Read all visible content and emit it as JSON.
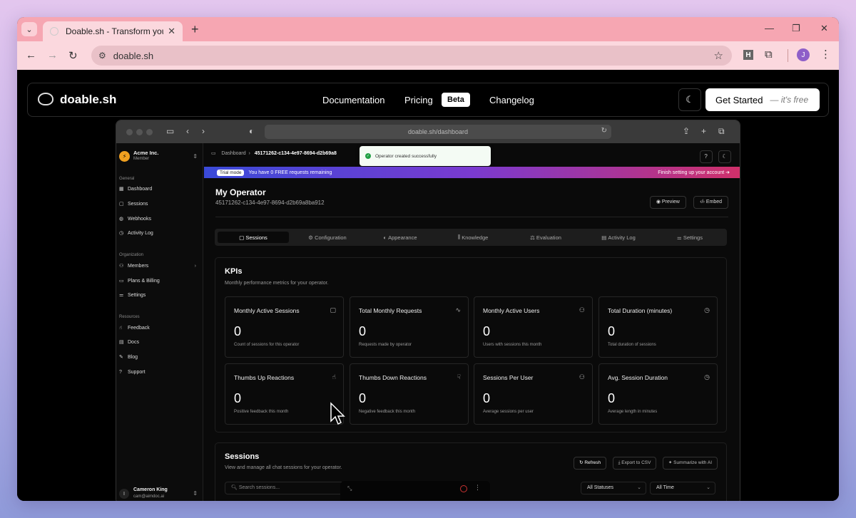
{
  "browser": {
    "tab_title": "Doable.sh - Transform your web",
    "url": "doable.sh",
    "profile_initial": "J",
    "extension_label": "H"
  },
  "site": {
    "logo": "doable.sh",
    "nav": [
      "Documentation",
      "Pricing",
      "Changelog"
    ],
    "beta_badge": "Beta",
    "cta_label": "Get Started",
    "cta_note": "— it's free"
  },
  "mock_browser": {
    "url": "doable.sh/dashboard"
  },
  "sidebar": {
    "org_name": "Acme Inc.",
    "org_role": "Member",
    "sections": [
      {
        "label": "General",
        "items": [
          "Dashboard",
          "Sessions",
          "Webhooks",
          "Activity Log"
        ]
      },
      {
        "label": "Organization",
        "items": [
          "Members",
          "Plans & Billing",
          "Settings"
        ]
      },
      {
        "label": "Resources",
        "items": [
          "Feedback",
          "Docs",
          "Blog",
          "Support"
        ]
      }
    ],
    "user_initial": "I",
    "user_name": "Cameron King",
    "user_email": "cam@aimdoc.ai"
  },
  "dashboard": {
    "breadcrumb_root": "Dashboard",
    "breadcrumb_current": "45171262-c134-4e97-8694-d2b69a8",
    "toast": "Operator created successfully",
    "trial_pill": "Trial mode",
    "trial_text": "You have 0 FREE requests remaining",
    "trial_action": "Finish setting up your account",
    "title": "My Operator",
    "operator_id": "45171262-c134-4e97-8694-d2b69a8ba912",
    "preview_label": "Preview",
    "embed_label": "Embed",
    "tabs": [
      "Sessions",
      "Configuration",
      "Appearance",
      "Knowledge",
      "Evaluation",
      "Activity Log",
      "Settings"
    ],
    "active_tab": "Sessions"
  },
  "kpis": {
    "title": "KPIs",
    "subtitle": "Monthly performance metrics for your operator.",
    "cards": [
      {
        "label": "Monthly Active Sessions",
        "value": "0",
        "desc": "Count of sessions for this operator",
        "icon": "chat-icon"
      },
      {
        "label": "Total Monthly Requests",
        "value": "0",
        "desc": "Requests made by operator",
        "icon": "activity-icon"
      },
      {
        "label": "Monthly Active Users",
        "value": "0",
        "desc": "Users with sessions this month",
        "icon": "users-icon"
      },
      {
        "label": "Total Duration (minutes)",
        "value": "0",
        "desc": "Total duration of sessions",
        "icon": "clock-icon"
      },
      {
        "label": "Thumbs Up Reactions",
        "value": "0",
        "desc": "Positive feedback this month",
        "icon": "thumbs-up-icon"
      },
      {
        "label": "Thumbs Down Reactions",
        "value": "0",
        "desc": "Negative feedback this month",
        "icon": "thumbs-down-icon"
      },
      {
        "label": "Sessions Per User",
        "value": "0",
        "desc": "Average sessions per user",
        "icon": "users-icon"
      },
      {
        "label": "Avg. Session Duration",
        "value": "0",
        "desc": "Average length in minutes",
        "icon": "clock-icon"
      }
    ]
  },
  "sessions": {
    "title": "Sessions",
    "subtitle": "View and manage all chat sessions for your operator.",
    "refresh_label": "Refresh",
    "export_label": "Export to CSV",
    "summarize_label": "Summarize with AI",
    "search_placeholder": "Search sessions...",
    "status_filter": "All Statuses",
    "time_filter": "All Time"
  }
}
